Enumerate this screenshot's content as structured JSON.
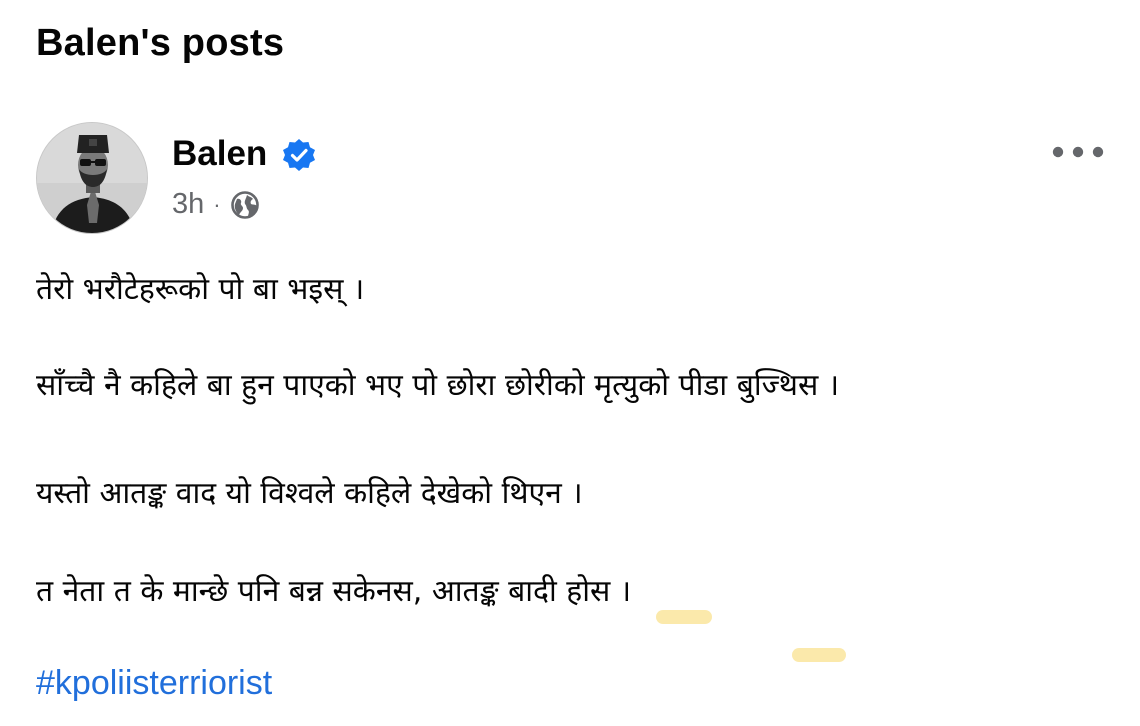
{
  "page": {
    "title": "Balen's posts"
  },
  "post": {
    "author": "Balen",
    "verified": true,
    "time": "3h",
    "separator": "·",
    "audience_icon": "globe-icon",
    "more_icon": "more-options-icon",
    "lines": [
      "तेरो भरौटेहरूको पो बा भइस् ।",
      "साँच्चै नै कहिले बा हुन पाएको  भए पो छोरा छोरीको मृत्युको पीडा बुज्थिस ।",
      "यस्तो आतङ्क वाद यो विश्वले कहिले देखेको थिएन ।",
      "त नेता त के मान्छे पनि बन्न सकेनस, आतङ्क बादी होस ।"
    ],
    "hashtag": "#kpoliisterriorist"
  },
  "colors": {
    "text": "#050505",
    "secondary": "#65676b",
    "link": "#216fdb",
    "verified": "#1877f2",
    "highlight": "#fbe8a6"
  }
}
